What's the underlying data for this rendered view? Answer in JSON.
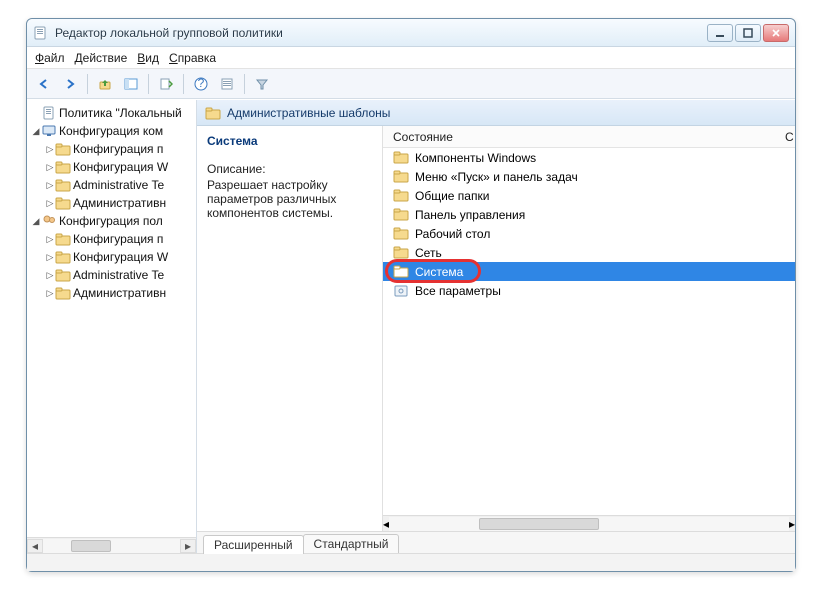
{
  "window": {
    "title": "Редактор локальной групповой политики"
  },
  "menu": {
    "file": "Файл",
    "action": "Действие",
    "view": "Вид",
    "help": "Справка"
  },
  "tree": {
    "root": "Политика \"Локальный",
    "nodes": [
      {
        "label": "Конфигурация ком",
        "type": "computer",
        "expanded": true,
        "children": [
          {
            "label": "Конфигурация п"
          },
          {
            "label": "Конфигурация W"
          },
          {
            "label": "Administrative Te"
          },
          {
            "label": "Административн"
          }
        ]
      },
      {
        "label": "Конфигурация пол",
        "type": "user",
        "expanded": true,
        "children": [
          {
            "label": "Конфигурация п"
          },
          {
            "label": "Конфигурация W"
          },
          {
            "label": "Administrative Te"
          },
          {
            "label": "Административн"
          }
        ]
      }
    ]
  },
  "path": {
    "label": "Административные шаблоны"
  },
  "desc": {
    "heading": "Система",
    "desc_label": "Описание:",
    "desc_text": "Разрешает настройку параметров различных компонентов системы."
  },
  "columns": {
    "state": "Состояние",
    "c": "С"
  },
  "items": [
    {
      "label": "Компоненты Windows",
      "type": "folder"
    },
    {
      "label": "Меню «Пуск» и панель задач",
      "type": "folder"
    },
    {
      "label": "Общие папки",
      "type": "folder"
    },
    {
      "label": "Панель управления",
      "type": "folder"
    },
    {
      "label": "Рабочий стол",
      "type": "folder"
    },
    {
      "label": "Сеть",
      "type": "folder"
    },
    {
      "label": "Система",
      "type": "folder",
      "selected": true
    },
    {
      "label": "Все параметры",
      "type": "settings"
    }
  ],
  "tabs": {
    "extended": "Расширенный",
    "standard": "Стандартный"
  }
}
